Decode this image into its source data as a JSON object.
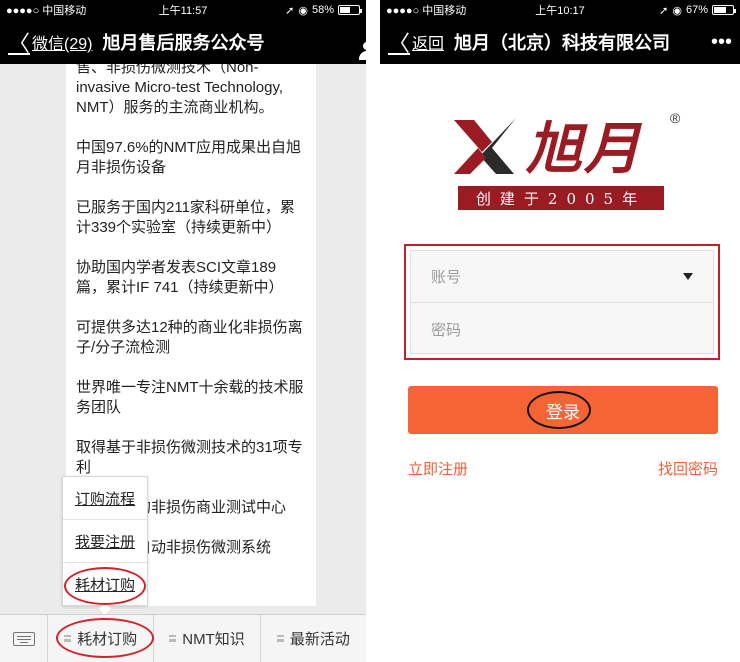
{
  "left": {
    "status": {
      "carrier": "●●●●○ 中国移动",
      "time": "上午11:57",
      "battery": "58%",
      "battery_level": 0.58
    },
    "nav": {
      "back_label": "微信(29)",
      "title": "旭月售后服务公众号"
    },
    "paragraphs": [
      "售、非损伤微测技术（Non-invasive Micro-test Technology, NMT）服务的主流商业机构。",
      "中国97.6%的NMT应用成果出自旭月非损伤设备",
      "已服务于国内211家科研单位，累计339个实验室（持续更新中）",
      "协助国内学者发表SCI文章189篇，累计IF 741（持续更新中）",
      "可提供多达12种的商业化非损伤离子/分子流检测",
      "世界唯一专注NMT十余载的技术服务团队",
      "取得基于非损伤微测技术的31项专利",
      "国内唯一的非损伤商业测试中心",
      "自主研发自动非损伤微测系统"
    ],
    "popup_menu": [
      "订购流程",
      "我要注册",
      "耗材订购"
    ],
    "menu_tabs": [
      "耗材订购",
      "NMT知识",
      "最新活动"
    ]
  },
  "right": {
    "status": {
      "carrier": "●●●●○ 中国移动",
      "time": "上午10:17",
      "battery": "67%",
      "battery_level": 0.67
    },
    "nav": {
      "back_label": "返回",
      "title": "旭月（北京）科技有限公司",
      "more": "•••"
    },
    "logo": {
      "name": "旭月",
      "registered": "®",
      "tagline": "创建于2005年"
    },
    "form": {
      "account_placeholder": "账号",
      "password_placeholder": "密码"
    },
    "login_label": "登录",
    "register_link": "立即注册",
    "recover_link": "找回密码"
  },
  "colors": {
    "brand_red": "#9b1b22",
    "login_orange": "#f56434",
    "link_orange": "#f0603a",
    "annotation_red": "#d2232a"
  },
  "icons": {
    "left_nav_right": "user-icon",
    "bottom_left": "keyboard-icon"
  }
}
